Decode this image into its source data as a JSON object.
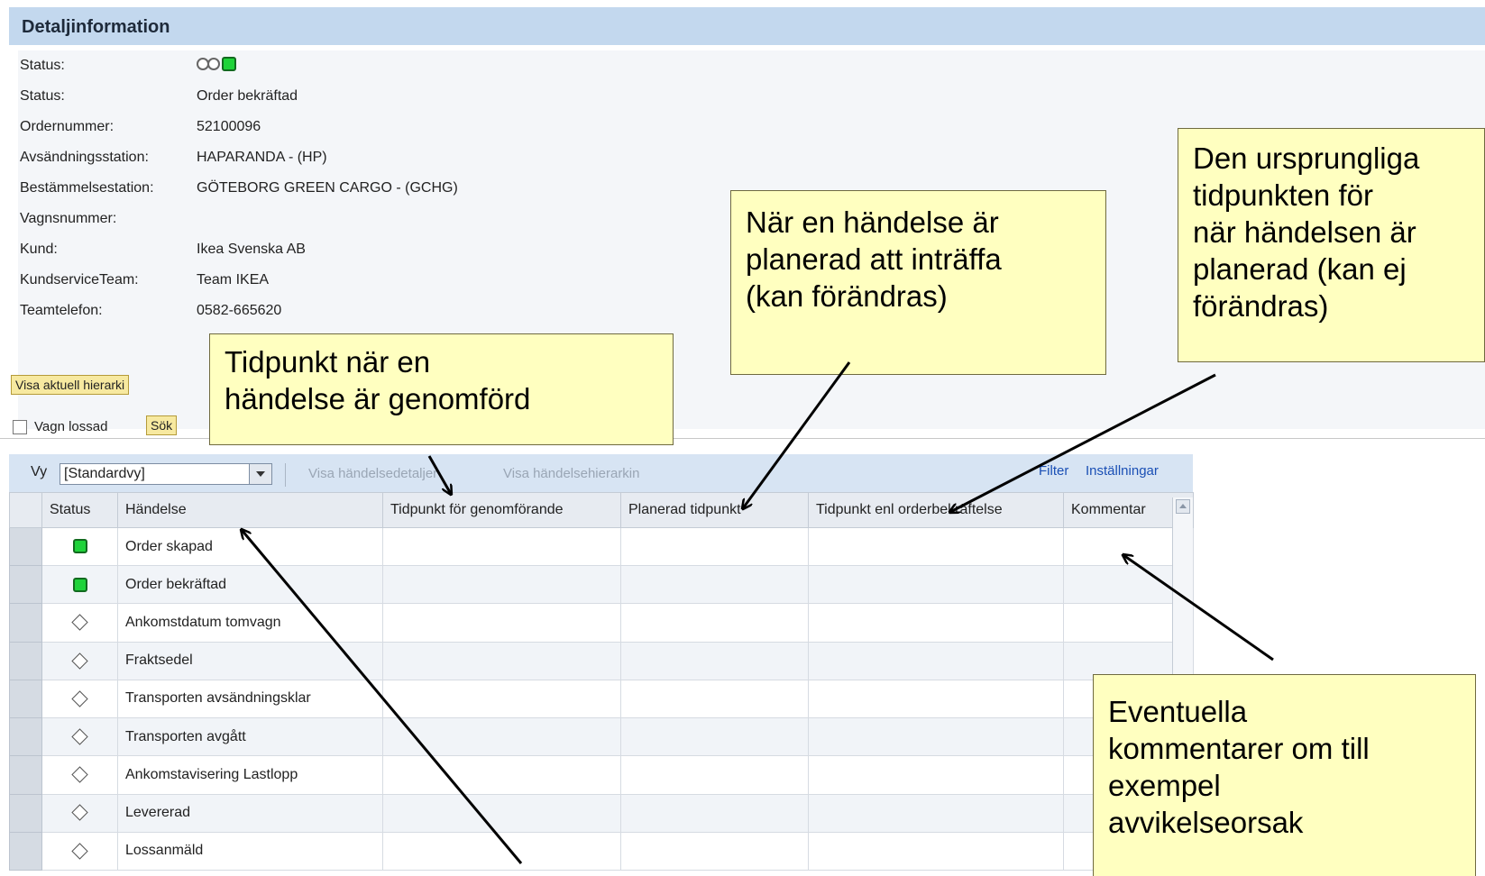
{
  "panel_title": "Detaljinformation",
  "details": [
    {
      "label": "Status:",
      "value": ""
    },
    {
      "label": "Status:",
      "value": "Order bekräftad"
    },
    {
      "label": "Ordernummer:",
      "value": "52100096"
    },
    {
      "label": "Avsändningsstation:",
      "value": "HAPARANDA - (HP)"
    },
    {
      "label": "Bestämmelsestation:",
      "value": "GÖTEBORG GREEN CARGO - (GCHG)"
    },
    {
      "label": "Vagnsnummer:",
      "value": ""
    },
    {
      "label": "Kund:",
      "value": "Ikea Svenska AB"
    },
    {
      "label": "KundserviceTeam:",
      "value": "Team IKEA"
    },
    {
      "label": "Teamtelefon:",
      "value": "0582-665620"
    }
  ],
  "status_indicator": {
    "icons": [
      "ring-icon",
      "ring-icon",
      "green-square-icon"
    ]
  },
  "buttons": {
    "hierarchy": "Visa aktuell hierarki",
    "search": "Sök"
  },
  "checkbox": {
    "label": "Vagn lossad",
    "checked": false
  },
  "toolbar": {
    "view_label": "Vy",
    "view_value": "[Standardvy]",
    "show_details": "Visa händelsedetaljer",
    "show_hierarchy": "Visa händelsehierarkin",
    "filter": "Filter",
    "settings": "Inställningar"
  },
  "table": {
    "columns": [
      "Status",
      "Händelse",
      "Tidpunkt för genomförande",
      "Planerad tidpunkt",
      "Tidpunkt enl orderbekräftelse",
      "Kommentar"
    ],
    "rows": [
      {
        "status": "green-square-icon",
        "event": "Order skapad"
      },
      {
        "status": "green-square-icon",
        "event": "Order bekräftad"
      },
      {
        "status": "diamond-icon",
        "event": "Ankomstdatum tomvagn"
      },
      {
        "status": "diamond-icon",
        "event": "Fraktsedel"
      },
      {
        "status": "diamond-icon",
        "event": "Transporten avsändningsklar"
      },
      {
        "status": "diamond-icon",
        "event": "Transporten avgått"
      },
      {
        "status": "diamond-icon",
        "event": "Ankomstavisering Lastlopp"
      },
      {
        "status": "diamond-icon",
        "event": "Levererad"
      },
      {
        "status": "diamond-icon",
        "event": "Lossanmäld"
      }
    ]
  },
  "callouts": {
    "executed": [
      "Tidpunkt när en",
      "händelse är genomförd"
    ],
    "planned": [
      "När en händelse är",
      "planerad att inträffa",
      "(kan förändras)"
    ],
    "original": [
      "Den ursprungliga",
      "tidpunkten för",
      "när händelsen är",
      "planerad (kan ej",
      "förändras)"
    ],
    "comments": [
      "Eventuella",
      "kommentarer om till",
      "exempel",
      "avvikelseorsak"
    ]
  },
  "colors": {
    "header_bg": "#c3d8ee",
    "status_green": "#1fd33a",
    "callout_bg": "#ffffc0",
    "link_blue": "#1a4fb5"
  }
}
